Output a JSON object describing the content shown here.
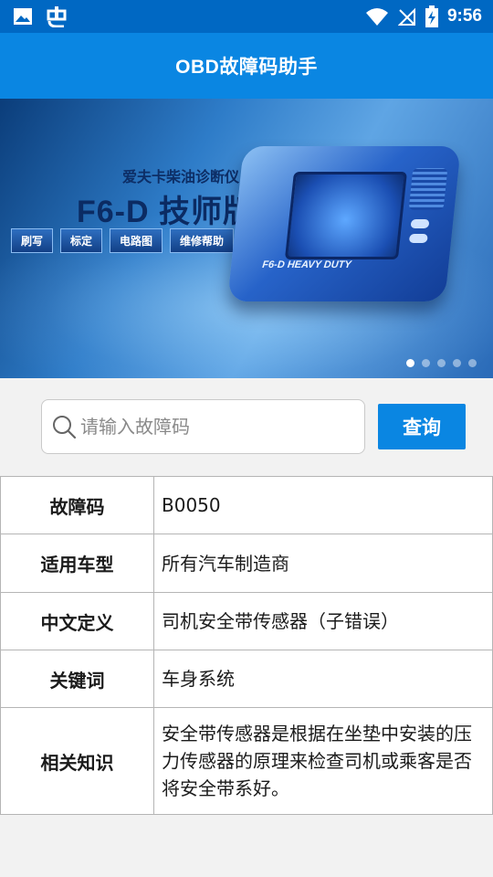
{
  "status_bar": {
    "time": "9:56",
    "left_icons": [
      "image-icon",
      "bug-icon"
    ],
    "right_icons": [
      "wifi-icon",
      "no-signal-icon",
      "battery-charging-icon"
    ]
  },
  "app_bar": {
    "title": "OBD故障码助手"
  },
  "banner": {
    "subtitle": "爱夫卡柴油诊断仪",
    "title": "F6-D 技师版",
    "tags": [
      "刷写",
      "标定",
      "电路图",
      "维修帮助"
    ],
    "device_label": "F6-D HEAVY DUTY",
    "page_count": 5,
    "active_page": 1
  },
  "search": {
    "placeholder": "请输入故障码",
    "value": "",
    "button_label": "查询"
  },
  "result_table": {
    "rows": [
      {
        "key": "故障码",
        "value": "B0050"
      },
      {
        "key": "适用车型",
        "value": "所有汽车制造商"
      },
      {
        "key": "中文定义",
        "value": "司机安全带传感器（子错误）"
      },
      {
        "key": "关键词",
        "value": "车身系统"
      },
      {
        "key": "相关知识",
        "value": "安全带传感器是根据在坐垫中安装的压力传感器的原理来检查司机或乘客是否将安全带系好。"
      }
    ]
  },
  "colors": {
    "status_bar": "#0068c3",
    "app_bar": "#0a86e2",
    "button": "#0a86e2",
    "background": "#f2f2f2"
  }
}
